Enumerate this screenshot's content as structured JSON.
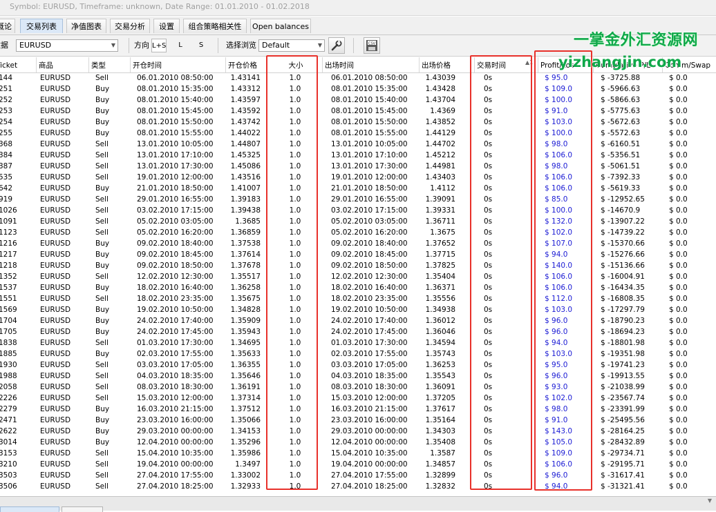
{
  "title": "Symbol: EURUSD, Timeframe: unknown, Date Range: 01.01.2010 - 01.02.2018",
  "tabs": [
    "概论",
    "交易列表",
    "净值图表",
    "交易分析",
    "设置",
    "组合策略相关性",
    "Open balances"
  ],
  "toolbar": {
    "data_label": "数据",
    "symbol": "EURUSD",
    "direction_label": "方向",
    "dir_options": [
      "L+S",
      "L",
      "S"
    ],
    "view_label": "选择浏览",
    "view_value": "Default",
    "export_icon": "csv-export-icon",
    "settings_icon": "wrench-icon"
  },
  "watermark": {
    "line1": "一掌金外汇资源网",
    "line2": "yizhangjin.com"
  },
  "columns": [
    "Ticket",
    "商品",
    "类型",
    "开仓时间",
    "开仓价格",
    "大小",
    "出场时间",
    "出场价格",
    "交易时间",
    "Profit/Loss",
    "Cumulative P/L",
    "Comm/Swap"
  ],
  "rows": [
    [
      "144",
      "EURUSD",
      "Sell",
      "06.01.2010 08:50:00",
      "1.43141",
      "1.0",
      "06.01.2010 08:50:00",
      "1.43039",
      "0s",
      "$ 95.0",
      "$ -3725.88",
      "$ 0.0"
    ],
    [
      "251",
      "EURUSD",
      "Buy",
      "08.01.2010 15:35:00",
      "1.43312",
      "1.0",
      "08.01.2010 15:35:00",
      "1.43428",
      "0s",
      "$ 109.0",
      "$ -5966.63",
      "$ 0.0"
    ],
    [
      "252",
      "EURUSD",
      "Buy",
      "08.01.2010 15:40:00",
      "1.43597",
      "1.0",
      "08.01.2010 15:40:00",
      "1.43704",
      "0s",
      "$ 100.0",
      "$ -5866.63",
      "$ 0.0"
    ],
    [
      "253",
      "EURUSD",
      "Buy",
      "08.01.2010 15:45:00",
      "1.43592",
      "1.0",
      "08.01.2010 15:45:00",
      "1.4369",
      "0s",
      "$ 91.0",
      "$ -5775.63",
      "$ 0.0"
    ],
    [
      "254",
      "EURUSD",
      "Buy",
      "08.01.2010 15:50:00",
      "1.43742",
      "1.0",
      "08.01.2010 15:50:00",
      "1.43852",
      "0s",
      "$ 103.0",
      "$ -5672.63",
      "$ 0.0"
    ],
    [
      "255",
      "EURUSD",
      "Buy",
      "08.01.2010 15:55:00",
      "1.44022",
      "1.0",
      "08.01.2010 15:55:00",
      "1.44129",
      "0s",
      "$ 100.0",
      "$ -5572.63",
      "$ 0.0"
    ],
    [
      "368",
      "EURUSD",
      "Sell",
      "13.01.2010 10:05:00",
      "1.44807",
      "1.0",
      "13.01.2010 10:05:00",
      "1.44702",
      "0s",
      "$ 98.0",
      "$ -6160.51",
      "$ 0.0"
    ],
    [
      "384",
      "EURUSD",
      "Sell",
      "13.01.2010 17:10:00",
      "1.45325",
      "1.0",
      "13.01.2010 17:10:00",
      "1.45212",
      "0s",
      "$ 106.0",
      "$ -5356.51",
      "$ 0.0"
    ],
    [
      "387",
      "EURUSD",
      "Sell",
      "13.01.2010 17:30:00",
      "1.45086",
      "1.0",
      "13.01.2010 17:30:00",
      "1.44981",
      "0s",
      "$ 98.0",
      "$ -5061.51",
      "$ 0.0"
    ],
    [
      "535",
      "EURUSD",
      "Sell",
      "19.01.2010 12:00:00",
      "1.43516",
      "1.0",
      "19.01.2010 12:00:00",
      "1.43403",
      "0s",
      "$ 106.0",
      "$ -7392.33",
      "$ 0.0"
    ],
    [
      "642",
      "EURUSD",
      "Buy",
      "21.01.2010 18:50:00",
      "1.41007",
      "1.0",
      "21.01.2010 18:50:00",
      "1.4112",
      "0s",
      "$ 106.0",
      "$ -5619.33",
      "$ 0.0"
    ],
    [
      "919",
      "EURUSD",
      "Sell",
      "29.01.2010 16:55:00",
      "1.39183",
      "1.0",
      "29.01.2010 16:55:00",
      "1.39091",
      "0s",
      "$ 85.0",
      "$ -12952.65",
      "$ 0.0"
    ],
    [
      "1026",
      "EURUSD",
      "Sell",
      "03.02.2010 17:15:00",
      "1.39438",
      "1.0",
      "03.02.2010 17:15:00",
      "1.39331",
      "0s",
      "$ 100.0",
      "$ -14670.9",
      "$ 0.0"
    ],
    [
      "1091",
      "EURUSD",
      "Sell",
      "05.02.2010 03:05:00",
      "1.3685",
      "1.0",
      "05.02.2010 03:05:00",
      "1.36711",
      "0s",
      "$ 132.0",
      "$ -13907.22",
      "$ 0.0"
    ],
    [
      "1123",
      "EURUSD",
      "Sell",
      "05.02.2010 16:20:00",
      "1.36859",
      "1.0",
      "05.02.2010 16:20:00",
      "1.3675",
      "0s",
      "$ 102.0",
      "$ -14739.22",
      "$ 0.0"
    ],
    [
      "1216",
      "EURUSD",
      "Buy",
      "09.02.2010 18:40:00",
      "1.37538",
      "1.0",
      "09.02.2010 18:40:00",
      "1.37652",
      "0s",
      "$ 107.0",
      "$ -15370.66",
      "$ 0.0"
    ],
    [
      "1217",
      "EURUSD",
      "Buy",
      "09.02.2010 18:45:00",
      "1.37614",
      "1.0",
      "09.02.2010 18:45:00",
      "1.37715",
      "0s",
      "$ 94.0",
      "$ -15276.66",
      "$ 0.0"
    ],
    [
      "1218",
      "EURUSD",
      "Buy",
      "09.02.2010 18:50:00",
      "1.37678",
      "1.0",
      "09.02.2010 18:50:00",
      "1.37825",
      "0s",
      "$ 140.0",
      "$ -15136.66",
      "$ 0.0"
    ],
    [
      "1352",
      "EURUSD",
      "Sell",
      "12.02.2010 12:30:00",
      "1.35517",
      "1.0",
      "12.02.2010 12:30:00",
      "1.35404",
      "0s",
      "$ 106.0",
      "$ -16004.91",
      "$ 0.0"
    ],
    [
      "1537",
      "EURUSD",
      "Buy",
      "18.02.2010 16:40:00",
      "1.36258",
      "1.0",
      "18.02.2010 16:40:00",
      "1.36371",
      "0s",
      "$ 106.0",
      "$ -16434.35",
      "$ 0.0"
    ],
    [
      "1551",
      "EURUSD",
      "Sell",
      "18.02.2010 23:35:00",
      "1.35675",
      "1.0",
      "18.02.2010 23:35:00",
      "1.35556",
      "0s",
      "$ 112.0",
      "$ -16808.35",
      "$ 0.0"
    ],
    [
      "1569",
      "EURUSD",
      "Buy",
      "19.02.2010 10:50:00",
      "1.34828",
      "1.0",
      "19.02.2010 10:50:00",
      "1.34938",
      "0s",
      "$ 103.0",
      "$ -17297.79",
      "$ 0.0"
    ],
    [
      "1704",
      "EURUSD",
      "Buy",
      "24.02.2010 17:40:00",
      "1.35909",
      "1.0",
      "24.02.2010 17:40:00",
      "1.36012",
      "0s",
      "$ 96.0",
      "$ -18790.23",
      "$ 0.0"
    ],
    [
      "1705",
      "EURUSD",
      "Buy",
      "24.02.2010 17:45:00",
      "1.35943",
      "1.0",
      "24.02.2010 17:45:00",
      "1.36046",
      "0s",
      "$ 96.0",
      "$ -18694.23",
      "$ 0.0"
    ],
    [
      "1838",
      "EURUSD",
      "Sell",
      "01.03.2010 17:30:00",
      "1.34695",
      "1.0",
      "01.03.2010 17:30:00",
      "1.34594",
      "0s",
      "$ 94.0",
      "$ -18801.98",
      "$ 0.0"
    ],
    [
      "1885",
      "EURUSD",
      "Buy",
      "02.03.2010 17:55:00",
      "1.35633",
      "1.0",
      "02.03.2010 17:55:00",
      "1.35743",
      "0s",
      "$ 103.0",
      "$ -19351.98",
      "$ 0.0"
    ],
    [
      "1930",
      "EURUSD",
      "Sell",
      "03.03.2010 17:05:00",
      "1.36355",
      "1.0",
      "03.03.2010 17:05:00",
      "1.36253",
      "0s",
      "$ 95.0",
      "$ -19741.23",
      "$ 0.0"
    ],
    [
      "1988",
      "EURUSD",
      "Sell",
      "04.03.2010 18:35:00",
      "1.35646",
      "1.0",
      "04.03.2010 18:35:00",
      "1.35543",
      "0s",
      "$ 96.0",
      "$ -19913.55",
      "$ 0.0"
    ],
    [
      "2058",
      "EURUSD",
      "Sell",
      "08.03.2010 18:30:00",
      "1.36191",
      "1.0",
      "08.03.2010 18:30:00",
      "1.36091",
      "0s",
      "$ 93.0",
      "$ -21038.99",
      "$ 0.0"
    ],
    [
      "2226",
      "EURUSD",
      "Sell",
      "15.03.2010 12:00:00",
      "1.37314",
      "1.0",
      "15.03.2010 12:00:00",
      "1.37205",
      "0s",
      "$ 102.0",
      "$ -23567.74",
      "$ 0.0"
    ],
    [
      "2279",
      "EURUSD",
      "Buy",
      "16.03.2010 21:15:00",
      "1.37512",
      "1.0",
      "16.03.2010 21:15:00",
      "1.37617",
      "0s",
      "$ 98.0",
      "$ -23391.99",
      "$ 0.0"
    ],
    [
      "2471",
      "EURUSD",
      "Buy",
      "23.03.2010 16:00:00",
      "1.35066",
      "1.0",
      "23.03.2010 16:00:00",
      "1.35164",
      "0s",
      "$ 91.0",
      "$ -25495.56",
      "$ 0.0"
    ],
    [
      "2622",
      "EURUSD",
      "Buy",
      "29.03.2010 00:00:00",
      "1.34153",
      "1.0",
      "29.03.2010 00:00:00",
      "1.34303",
      "0s",
      "$ 143.0",
      "$ -28164.25",
      "$ 0.0"
    ],
    [
      "3014",
      "EURUSD",
      "Buy",
      "12.04.2010 00:00:00",
      "1.35296",
      "1.0",
      "12.04.2010 00:00:00",
      "1.35408",
      "0s",
      "$ 105.0",
      "$ -28432.89",
      "$ 0.0"
    ],
    [
      "3153",
      "EURUSD",
      "Sell",
      "15.04.2010 10:35:00",
      "1.35986",
      "1.0",
      "15.04.2010 10:35:00",
      "1.3587",
      "0s",
      "$ 109.0",
      "$ -29734.71",
      "$ 0.0"
    ],
    [
      "3210",
      "EURUSD",
      "Sell",
      "19.04.2010 00:00:00",
      "1.3497",
      "1.0",
      "19.04.2010 00:00:00",
      "1.34857",
      "0s",
      "$ 106.0",
      "$ -29195.71",
      "$ 0.0"
    ],
    [
      "3503",
      "EURUSD",
      "Sell",
      "27.04.2010 17:55:00",
      "1.33002",
      "1.0",
      "27.04.2010 17:55:00",
      "1.32899",
      "0s",
      "$ 96.0",
      "$ -31617.41",
      "$ 0.0"
    ],
    [
      "3506",
      "EURUSD",
      "Sell",
      "27.04.2010 18:25:00",
      "1.32933",
      "1.0",
      "27.04.2010 18:25:00",
      "1.32832",
      "0s",
      "$ 94.0",
      "$ -31321.41",
      "$ 0.0"
    ]
  ],
  "colors": {
    "highlight": "#e8302a",
    "profit_text": "#1a1ad4"
  }
}
